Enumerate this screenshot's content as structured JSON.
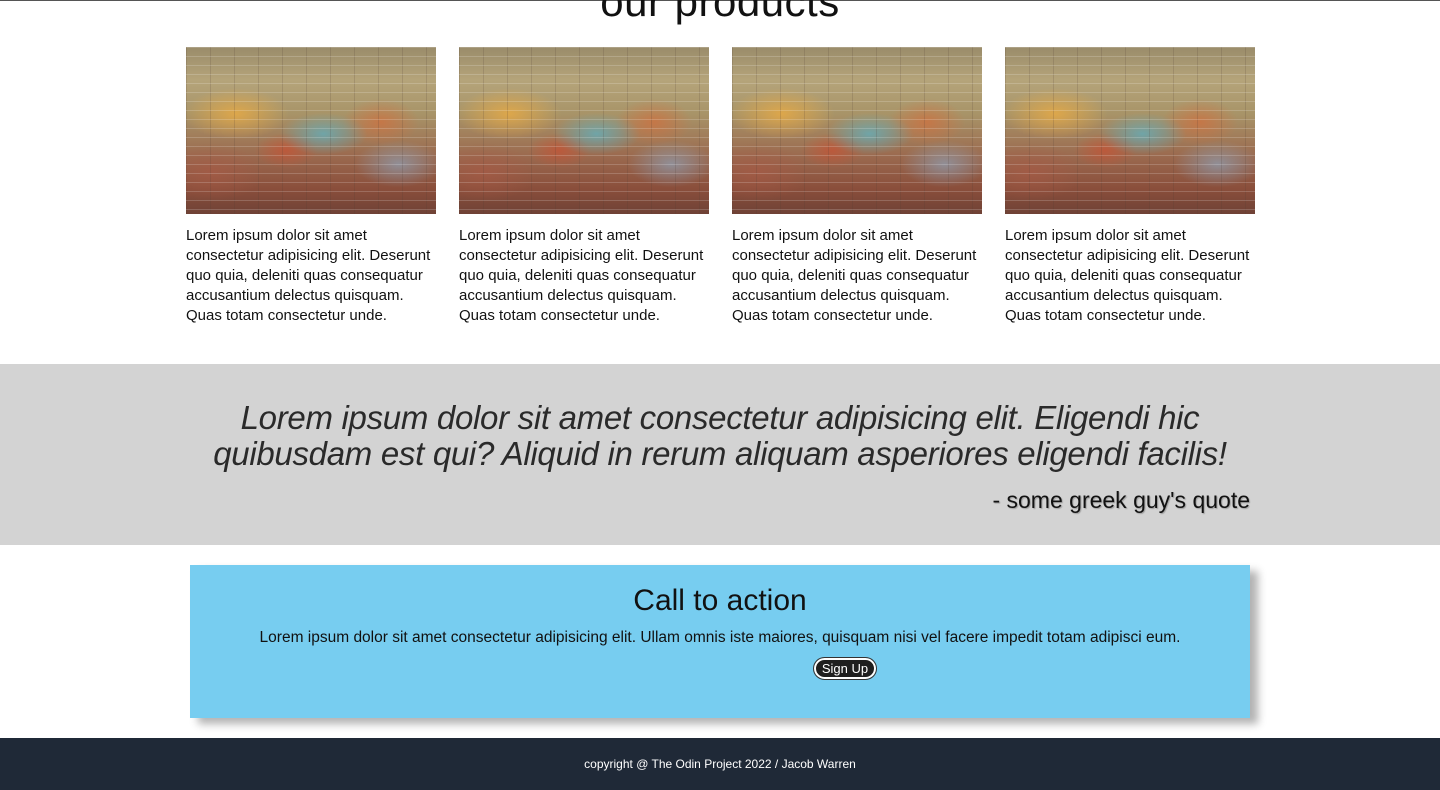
{
  "products": {
    "title": "our products",
    "items": [
      {
        "image_alt": "brick-wall-graffiti",
        "text": "Lorem ipsum dolor sit amet consectetur adipisicing elit. Deserunt quo quia, deleniti quas consequatur accusantium delectus quisquam. Quas totam consectetur unde."
      },
      {
        "image_alt": "brick-wall-graffiti",
        "text": "Lorem ipsum dolor sit amet consectetur adipisicing elit. Deserunt quo quia, deleniti quas consequatur accusantium delectus quisquam. Quas totam consectetur unde."
      },
      {
        "image_alt": "brick-wall-graffiti",
        "text": "Lorem ipsum dolor sit amet consectetur adipisicing elit. Deserunt quo quia, deleniti quas consequatur accusantium delectus quisquam. Quas totam consectetur unde."
      },
      {
        "image_alt": "brick-wall-graffiti",
        "text": "Lorem ipsum dolor sit amet consectetur adipisicing elit. Deserunt quo quia, deleniti quas consequatur accusantium delectus quisquam. Quas totam consectetur unde."
      }
    ]
  },
  "quote": {
    "text": "Lorem ipsum dolor sit amet consectetur adipisicing elit. Eligendi hic quibusdam est qui? Aliquid in rerum aliquam asperiores eligendi facilis!",
    "author": "- some greek guy's quote"
  },
  "cta": {
    "title": "Call to action",
    "text": "Lorem ipsum dolor sit amet consectetur adipisicing elit. Ullam omnis iste maiores, quisquam nisi vel facere impedit totam adipisci eum.",
    "button_label": "Sign Up"
  },
  "footer": {
    "text": "copyright @ The Odin Project 2022 / Jacob Warren"
  },
  "colors": {
    "quote_band": "#d3d3d3",
    "cta_background": "#77cdf0",
    "footer_background": "#1f2937"
  }
}
